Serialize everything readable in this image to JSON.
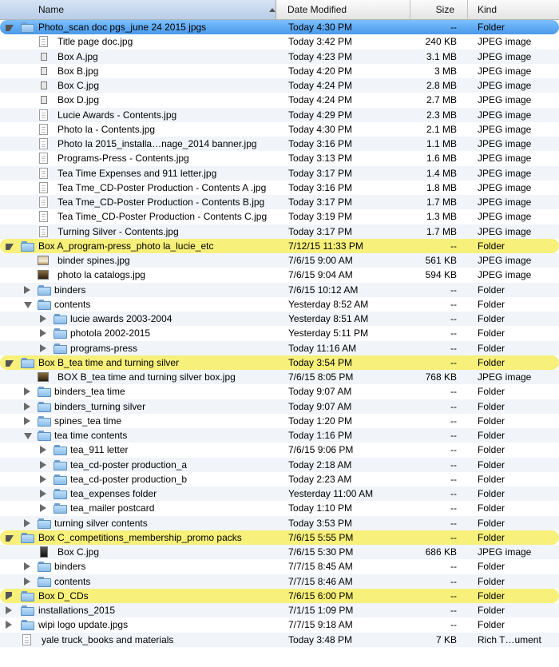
{
  "columns": {
    "name": "Name",
    "date": "Date Modified",
    "size": "Size",
    "kind": "Kind"
  },
  "rows": [
    {
      "name": "Photo_scan doc pgs_june 24 2015 jpgs",
      "date": "Today 4:30 PM",
      "size": "--",
      "kind": "Folder",
      "level": 0,
      "type": "folder",
      "disclosure": "open",
      "highlight": "blue"
    },
    {
      "name": "Title page doc.jpg",
      "date": "Today 3:42 PM",
      "size": "240 KB",
      "kind": "JPEG image",
      "level": 1,
      "type": "doc"
    },
    {
      "name": "Box A.jpg",
      "date": "Today 4:23 PM",
      "size": "3.1 MB",
      "kind": "JPEG image",
      "level": 1,
      "type": "photo-small"
    },
    {
      "name": "Box B.jpg",
      "date": "Today 4:20 PM",
      "size": "3 MB",
      "kind": "JPEG image",
      "level": 1,
      "type": "photo-small"
    },
    {
      "name": "Box C.jpg",
      "date": "Today 4:24 PM",
      "size": "2.8 MB",
      "kind": "JPEG image",
      "level": 1,
      "type": "photo-small"
    },
    {
      "name": "Box D.jpg",
      "date": "Today 4:24 PM",
      "size": "2.7 MB",
      "kind": "JPEG image",
      "level": 1,
      "type": "photo-small"
    },
    {
      "name": "Lucie Awards - Contents.jpg",
      "date": "Today 4:29 PM",
      "size": "2.3 MB",
      "kind": "JPEG image",
      "level": 1,
      "type": "doc"
    },
    {
      "name": "Photo la - Contents.jpg",
      "date": "Today 4:30 PM",
      "size": "2.1 MB",
      "kind": "JPEG image",
      "level": 1,
      "type": "doc"
    },
    {
      "name": "Photo la 2015_installa…nage_2014 banner.jpg",
      "date": "Today 3:16 PM",
      "size": "1.1 MB",
      "kind": "JPEG image",
      "level": 1,
      "type": "doc"
    },
    {
      "name": "Programs-Press - Contents.jpg",
      "date": "Today 3:13 PM",
      "size": "1.6 MB",
      "kind": "JPEG image",
      "level": 1,
      "type": "doc"
    },
    {
      "name": "Tea Time Expenses and 911 letter.jpg",
      "date": "Today 3:17 PM",
      "size": "1.4 MB",
      "kind": "JPEG image",
      "level": 1,
      "type": "doc"
    },
    {
      "name": "Tea Tme_CD-Poster Production - Contents A .jpg",
      "date": "Today 3:16 PM",
      "size": "1.8 MB",
      "kind": "JPEG image",
      "level": 1,
      "type": "doc"
    },
    {
      "name": "Tea Tme_CD-Poster Production - Contents B.jpg",
      "date": "Today 3:17 PM",
      "size": "1.7 MB",
      "kind": "JPEG image",
      "level": 1,
      "type": "doc"
    },
    {
      "name": "Tea Time_CD-Poster Production - Contents C.jpg",
      "date": "Today 3:19 PM",
      "size": "1.3 MB",
      "kind": "JPEG image",
      "level": 1,
      "type": "doc"
    },
    {
      "name": "Turning Silver - Contents.jpg",
      "date": "Today 3:17 PM",
      "size": "1.7 MB",
      "kind": "JPEG image",
      "level": 1,
      "type": "doc"
    },
    {
      "name": "Box A_program-press_photo la_lucie_etc",
      "date": "7/12/15 11:33 PM",
      "size": "--",
      "kind": "Folder",
      "level": 0,
      "type": "folder",
      "disclosure": "open",
      "highlight": "yellow"
    },
    {
      "name": "binder spines.jpg",
      "date": "7/6/15 9:00 AM",
      "size": "561 KB",
      "kind": "JPEG image",
      "level": 1,
      "type": "photo-light"
    },
    {
      "name": "photo la catalogs.jpg",
      "date": "7/6/15 9:04 AM",
      "size": "594 KB",
      "kind": "JPEG image",
      "level": 1,
      "type": "photo-dark"
    },
    {
      "name": "binders",
      "date": "7/6/15 10:12 AM",
      "size": "--",
      "kind": "Folder",
      "level": 1,
      "type": "folder",
      "disclosure": "closed"
    },
    {
      "name": "contents",
      "date": "Yesterday 8:52 AM",
      "size": "--",
      "kind": "Folder",
      "level": 1,
      "type": "folder",
      "disclosure": "open"
    },
    {
      "name": "lucie awards 2003-2004",
      "date": "Yesterday 8:51 AM",
      "size": "--",
      "kind": "Folder",
      "level": 2,
      "type": "folder",
      "disclosure": "closed"
    },
    {
      "name": "photola 2002-2015",
      "date": "Yesterday 5:11 PM",
      "size": "--",
      "kind": "Folder",
      "level": 2,
      "type": "folder",
      "disclosure": "closed"
    },
    {
      "name": "programs-press",
      "date": "Today 11:16 AM",
      "size": "--",
      "kind": "Folder",
      "level": 2,
      "type": "folder",
      "disclosure": "closed"
    },
    {
      "name": "Box B_tea time and turning silver",
      "date": "Today 3:54 PM",
      "size": "--",
      "kind": "Folder",
      "level": 0,
      "type": "folder",
      "disclosure": "open",
      "highlight": "yellow"
    },
    {
      "name": "BOX B_tea time and turning silver box.jpg",
      "date": "7/6/15 8:05 PM",
      "size": "768 KB",
      "kind": "JPEG image",
      "level": 1,
      "type": "photo-dark"
    },
    {
      "name": "binders_tea time",
      "date": "Today 9:07 AM",
      "size": "--",
      "kind": "Folder",
      "level": 1,
      "type": "folder",
      "disclosure": "closed"
    },
    {
      "name": "binders_turning silver",
      "date": "Today 9:07 AM",
      "size": "--",
      "kind": "Folder",
      "level": 1,
      "type": "folder",
      "disclosure": "closed"
    },
    {
      "name": "spines_tea time",
      "date": "Today 1:20 PM",
      "size": "--",
      "kind": "Folder",
      "level": 1,
      "type": "folder",
      "disclosure": "closed"
    },
    {
      "name": "tea time contents",
      "date": "Today 1:16 PM",
      "size": "--",
      "kind": "Folder",
      "level": 1,
      "type": "folder",
      "disclosure": "open"
    },
    {
      "name": "tea_911 letter",
      "date": "7/6/15 9:06 PM",
      "size": "--",
      "kind": "Folder",
      "level": 2,
      "type": "folder",
      "disclosure": "closed"
    },
    {
      "name": "tea_cd-poster production_a",
      "date": "Today 2:18 AM",
      "size": "--",
      "kind": "Folder",
      "level": 2,
      "type": "folder",
      "disclosure": "closed"
    },
    {
      "name": "tea_cd-poster production_b",
      "date": "Today 2:23 AM",
      "size": "--",
      "kind": "Folder",
      "level": 2,
      "type": "folder",
      "disclosure": "closed"
    },
    {
      "name": "tea_expenses folder",
      "date": "Yesterday 11:00 AM",
      "size": "--",
      "kind": "Folder",
      "level": 2,
      "type": "folder",
      "disclosure": "closed"
    },
    {
      "name": "tea_mailer postcard",
      "date": "Today 1:10 PM",
      "size": "--",
      "kind": "Folder",
      "level": 2,
      "type": "folder",
      "disclosure": "closed"
    },
    {
      "name": "turning silver contents",
      "date": "Today 3:53 PM",
      "size": "--",
      "kind": "Folder",
      "level": 1,
      "type": "folder",
      "disclosure": "closed"
    },
    {
      "name": "Box C_competitions_membership_promo packs",
      "date": "7/6/15 5:55 PM",
      "size": "--",
      "kind": "Folder",
      "level": 0,
      "type": "folder",
      "disclosure": "open",
      "highlight": "yellow"
    },
    {
      "name": "Box C.jpg",
      "date": "7/6/15 5:30 PM",
      "size": "686 KB",
      "kind": "JPEG image",
      "level": 1,
      "type": "photo-tall"
    },
    {
      "name": "binders",
      "date": "7/7/15 8:45 AM",
      "size": "--",
      "kind": "Folder",
      "level": 1,
      "type": "folder",
      "disclosure": "closed"
    },
    {
      "name": "contents",
      "date": "7/7/15 8:46 AM",
      "size": "--",
      "kind": "Folder",
      "level": 1,
      "type": "folder",
      "disclosure": "closed"
    },
    {
      "name": "Box D_CDs",
      "date": "7/6/15 6:00 PM",
      "size": "--",
      "kind": "Folder",
      "level": 0,
      "type": "folder",
      "disclosure": "closed",
      "highlight": "yellow"
    },
    {
      "name": "installations_2015",
      "date": "7/1/15 1:09 PM",
      "size": "--",
      "kind": "Folder",
      "level": 0,
      "type": "folder",
      "disclosure": "closed"
    },
    {
      "name": "wipi logo update.jpgs",
      "date": "7/7/15 9:18 AM",
      "size": "--",
      "kind": "Folder",
      "level": 0,
      "type": "folder",
      "disclosure": "closed"
    },
    {
      "name": "yale truck_books and materials",
      "date": "Today 3:48 PM",
      "size": "7 KB",
      "kind": "Rich T…ument",
      "level": 0,
      "type": "doc"
    }
  ]
}
